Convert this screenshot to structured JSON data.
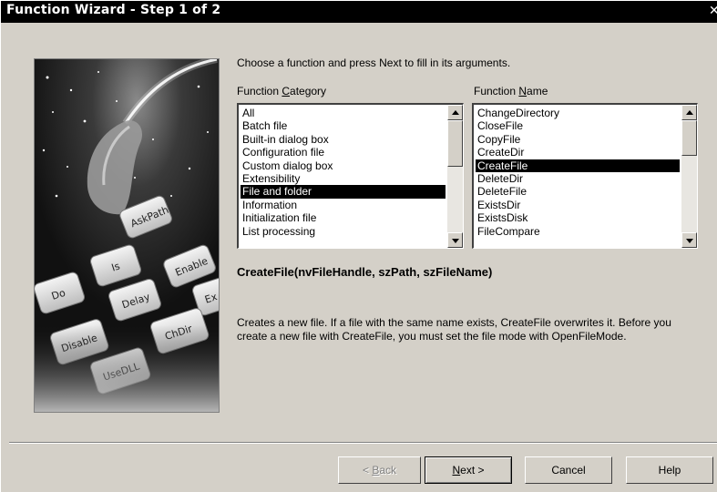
{
  "window": {
    "title": "Function Wizard - Step 1 of 2",
    "close_glyph": "✕"
  },
  "intro_text": "Choose a function and press Next to fill in its arguments.",
  "category": {
    "label_prefix": "Function ",
    "label_accel": "C",
    "label_suffix": "ategory",
    "items": [
      "All",
      "Batch file",
      "Built-in dialog box",
      "Configuration file",
      "Custom dialog box",
      "Extensibility",
      "File and folder",
      "Information",
      "Initialization file",
      "List processing"
    ],
    "selected": "File and folder"
  },
  "function_name": {
    "label_prefix": "Function ",
    "label_accel": "N",
    "label_suffix": "ame",
    "items": [
      "ChangeDirectory",
      "CloseFile",
      "CopyFile",
      "CreateDir",
      "CreateFile",
      "DeleteDir",
      "DeleteFile",
      "ExistsDir",
      "ExistsDisk",
      "FileCompare"
    ],
    "selected": "CreateFile"
  },
  "signature": "CreateFile(nvFileHandle, szPath, szFileName)",
  "description": "Creates a new file. If a file with the same name exists, CreateFile overwrites it. Before you create a new file with CreateFile, you must set the file mode with OpenFileMode.",
  "art_keys": [
    "AskPath",
    "Enable",
    "Is",
    "Do",
    "Delay",
    "Disable",
    "ChDir",
    "UseDLL",
    "Ex"
  ],
  "buttons": {
    "back": {
      "prefix": "< ",
      "accel": "B",
      "suffix": "ack",
      "enabled": false
    },
    "next": {
      "prefix": "",
      "accel": "N",
      "suffix": "ext >",
      "enabled": true
    },
    "cancel": {
      "label": "Cancel"
    },
    "help": {
      "label": "Help"
    }
  },
  "colors": {
    "dialog_bg": "#d4d0c8",
    "titlebar_bg": "#000000",
    "selection_bg": "#000000"
  }
}
